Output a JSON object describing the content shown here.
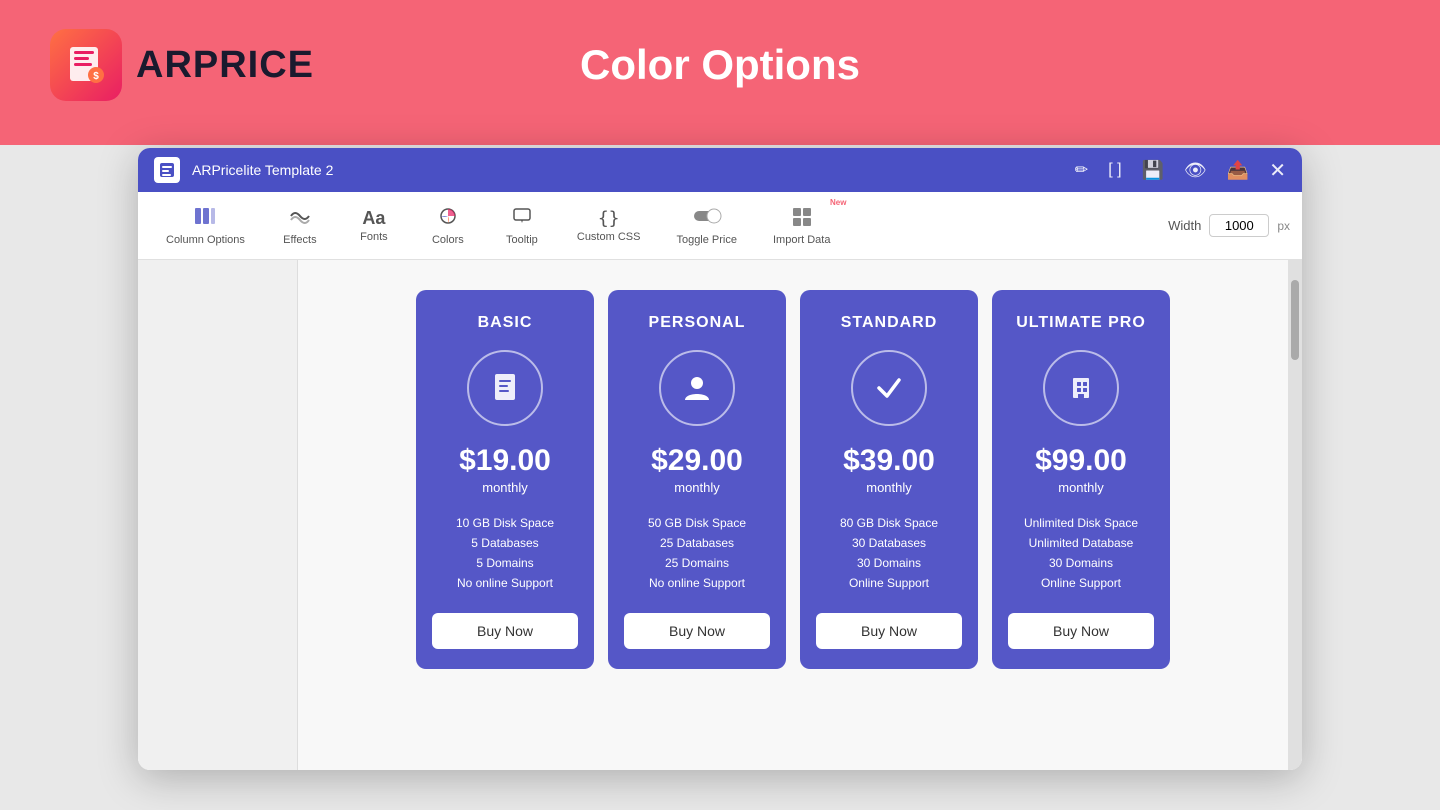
{
  "brand": {
    "logo_text": "ARPRICE",
    "header_title": "Color Options"
  },
  "window": {
    "title": "ARPricelite Template 2",
    "width_value": "1000",
    "width_unit": "px"
  },
  "toolbar": {
    "items": [
      {
        "id": "column-options",
        "label": "Column Options",
        "icon": "⊞",
        "active": false
      },
      {
        "id": "effects",
        "label": "Effects",
        "icon": "⇄",
        "active": false
      },
      {
        "id": "fonts",
        "label": "Fonts",
        "icon": "Aa",
        "active": false
      },
      {
        "id": "colors",
        "label": "Colors",
        "icon": "🎨",
        "active": false
      },
      {
        "id": "tooltip",
        "label": "Tooltip",
        "icon": "☐",
        "active": false
      },
      {
        "id": "custom-css",
        "label": "Custom CSS",
        "icon": "{}",
        "active": false
      },
      {
        "id": "toggle-price",
        "label": "Toggle Price",
        "icon": "⊙",
        "active": false
      },
      {
        "id": "import-data",
        "label": "Import Data",
        "icon": "⊞",
        "active": false,
        "new": true
      }
    ],
    "width_label": "Width"
  },
  "pricing": {
    "cards": [
      {
        "id": "basic",
        "title": "BASIC",
        "price": "$19.00",
        "period": "monthly",
        "features": [
          "10 GB Disk Space",
          "5 Databases",
          "5 Domains",
          "No online Support"
        ],
        "btn_label": "Buy Now"
      },
      {
        "id": "personal",
        "title": "PERSONAL",
        "price": "$29.00",
        "period": "monthly",
        "features": [
          "50 GB Disk Space",
          "25 Databases",
          "25 Domains",
          "No online Support"
        ],
        "btn_label": "Buy Now"
      },
      {
        "id": "standard",
        "title": "STANDARD",
        "price": "$39.00",
        "period": "monthly",
        "features": [
          "80 GB Disk Space",
          "30 Databases",
          "30 Domains",
          "Online Support"
        ],
        "btn_label": "Buy Now"
      },
      {
        "id": "ultimate-pro",
        "title": "ULTIMATE PRO",
        "price": "$99.00",
        "period": "monthly",
        "features": [
          "Unlimited Disk Space",
          "Unlimited Database",
          "30 Domains",
          "Online Support"
        ],
        "btn_label": "Buy Now"
      }
    ]
  },
  "icons": {
    "basic": "📄",
    "personal": "👤",
    "standard": "✓",
    "ultimate_pro": "🏢"
  }
}
